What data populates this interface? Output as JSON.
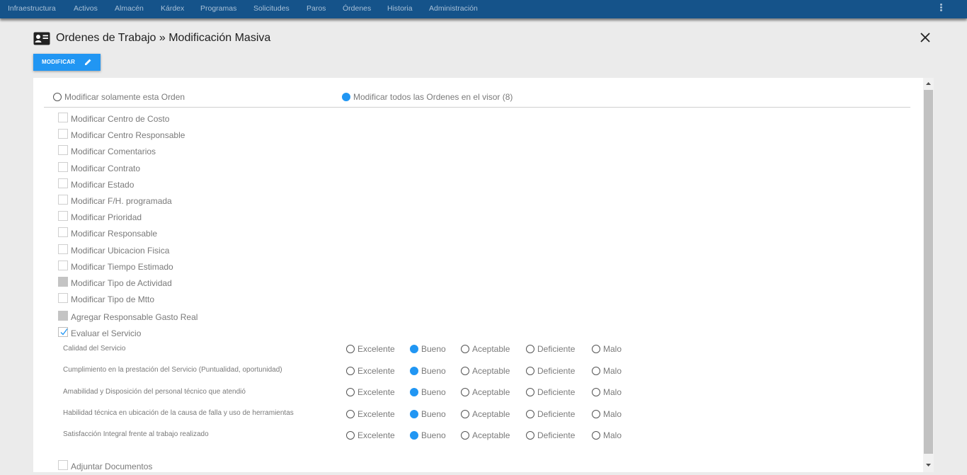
{
  "nav": {
    "items": [
      "Infraestructura",
      "Activos",
      "Almacén",
      "Kárdex",
      "Programas",
      "Solicitudes",
      "Paros",
      "Órdenes",
      "Historia",
      "Administración"
    ]
  },
  "header": {
    "title": "Ordenes de Trabajo » Modificación Masiva"
  },
  "toolbar": {
    "modify_label": "MODIFICAR"
  },
  "scope": {
    "option_single": "Modificar solamente esta Orden",
    "option_all": "Modificar todos las Ordenes en el visor (8)",
    "selected": "all"
  },
  "options": [
    {
      "label": "Modificar Centro de Costo",
      "state": "unchecked"
    },
    {
      "label": "Modificar Centro Responsable",
      "state": "unchecked"
    },
    {
      "label": "Modificar Comentarios",
      "state": "unchecked"
    },
    {
      "label": "Modificar Contrato",
      "state": "unchecked"
    },
    {
      "label": "Modificar Estado",
      "state": "unchecked"
    },
    {
      "label": "Modificar F/H. programada",
      "state": "unchecked"
    },
    {
      "label": "Modificar Prioridad",
      "state": "unchecked"
    },
    {
      "label": "Modificar Responsable",
      "state": "unchecked"
    },
    {
      "label": "Modificar Ubicacion Fisica",
      "state": "unchecked"
    },
    {
      "label": "Modificar Tiempo Estimado",
      "state": "unchecked"
    },
    {
      "label": "Modificar Tipo de Actividad",
      "state": "disabled"
    },
    {
      "label": "Modificar Tipo de Mtto",
      "state": "unchecked"
    },
    {
      "label": "Agregar Responsable Gasto Real",
      "state": "disabled"
    },
    {
      "label": "Evaluar el Servicio",
      "state": "checked"
    }
  ],
  "evaluation": {
    "ratings": [
      "Excelente",
      "Bueno",
      "Aceptable",
      "Deficiente",
      "Malo"
    ],
    "criteria": [
      {
        "label": "Calidad del Servicio",
        "selected": "Bueno"
      },
      {
        "label": "Cumplimiento en la prestación del Servicio (Puntualidad, oportunidad)",
        "selected": "Bueno"
      },
      {
        "label": "Amabilidad y Disposición del personal técnico que atendió",
        "selected": "Bueno"
      },
      {
        "label": "Habilidad técnica en ubicación de la causa de falla y uso de herramientas",
        "selected": "Bueno"
      },
      {
        "label": "Satisfacción Integral frente al trabajo realizado",
        "selected": "Bueno"
      }
    ]
  },
  "attach": {
    "label": "Adjuntar Documentos",
    "state": "unchecked"
  },
  "colors": {
    "nav_bg": "#15538a",
    "accent": "#2196f3",
    "page_bg": "#ebebeb"
  },
  "icons": [
    "contact-card-icon",
    "close-icon",
    "pencil-icon",
    "kebab-menu-icon",
    "scroll-up-icon",
    "scroll-down-icon",
    "checkmark-icon"
  ]
}
